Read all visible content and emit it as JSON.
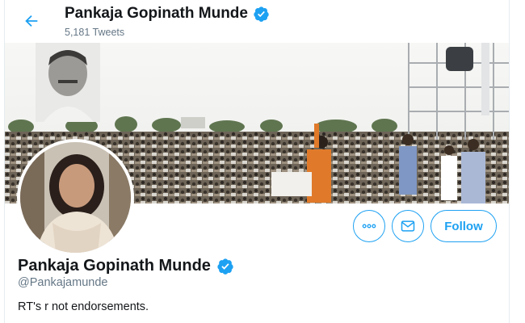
{
  "header": {
    "name": "Pankaja Gopinath Munde",
    "tweet_count": "5,181 Tweets",
    "back_icon": "back-arrow-icon",
    "verified_icon": "verified-badge-icon"
  },
  "profile": {
    "name": "Pankaja Gopinath Munde",
    "handle": "@Pankajamunde",
    "bio": "RT's r not endorsements."
  },
  "actions": {
    "more_icon": "more-icon",
    "message_icon": "envelope-icon",
    "follow_label": "Follow"
  },
  "colors": {
    "accent": "#1da1f2",
    "text": "#14171a",
    "secondary_text": "#657786"
  }
}
